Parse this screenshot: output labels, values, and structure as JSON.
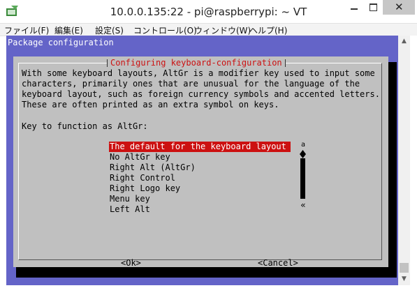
{
  "window": {
    "title": "10.0.0.135:22 - pi@raspberrypi: ~ VT",
    "close_glyph": "✕"
  },
  "menu": [
    {
      "label": "ファイル(F)"
    },
    {
      "label": "編集(E)"
    },
    {
      "label": "設定(S)"
    },
    {
      "label": "コントロール(O)"
    },
    {
      "label": "ウィンドウ(W)"
    },
    {
      "label": "ヘルプ(H)"
    }
  ],
  "terminal": {
    "header": "Package configuration",
    "dialog": {
      "title": "Configuring keyboard-configuration",
      "description": [
        "With some keyboard layouts, AltGr is a modifier key used to input some",
        "characters, primarily ones that are unusual for the language of the",
        "keyboard layout, such as foreign currency symbols and accented letters.",
        "These are often printed as an extra symbol on keys."
      ],
      "prompt": "Key to function as AltGr:",
      "options": [
        "The default for the keyboard layout",
        "No AltGr key",
        "Right Alt (AltGr)",
        "Right Control",
        "Right Logo key",
        "Menu key",
        "Left Alt"
      ],
      "selected_index": 0,
      "scroll_top": "a",
      "scroll_bottom": "«",
      "ok_label": "<Ok>",
      "cancel_label": "<Cancel>"
    }
  },
  "scrollbar": {
    "up": "▲",
    "down": "▼"
  },
  "colors": {
    "terminal_bg": "#6464c8",
    "dialog_bg": "#c0c0c0",
    "accent_red": "#cc1111"
  }
}
